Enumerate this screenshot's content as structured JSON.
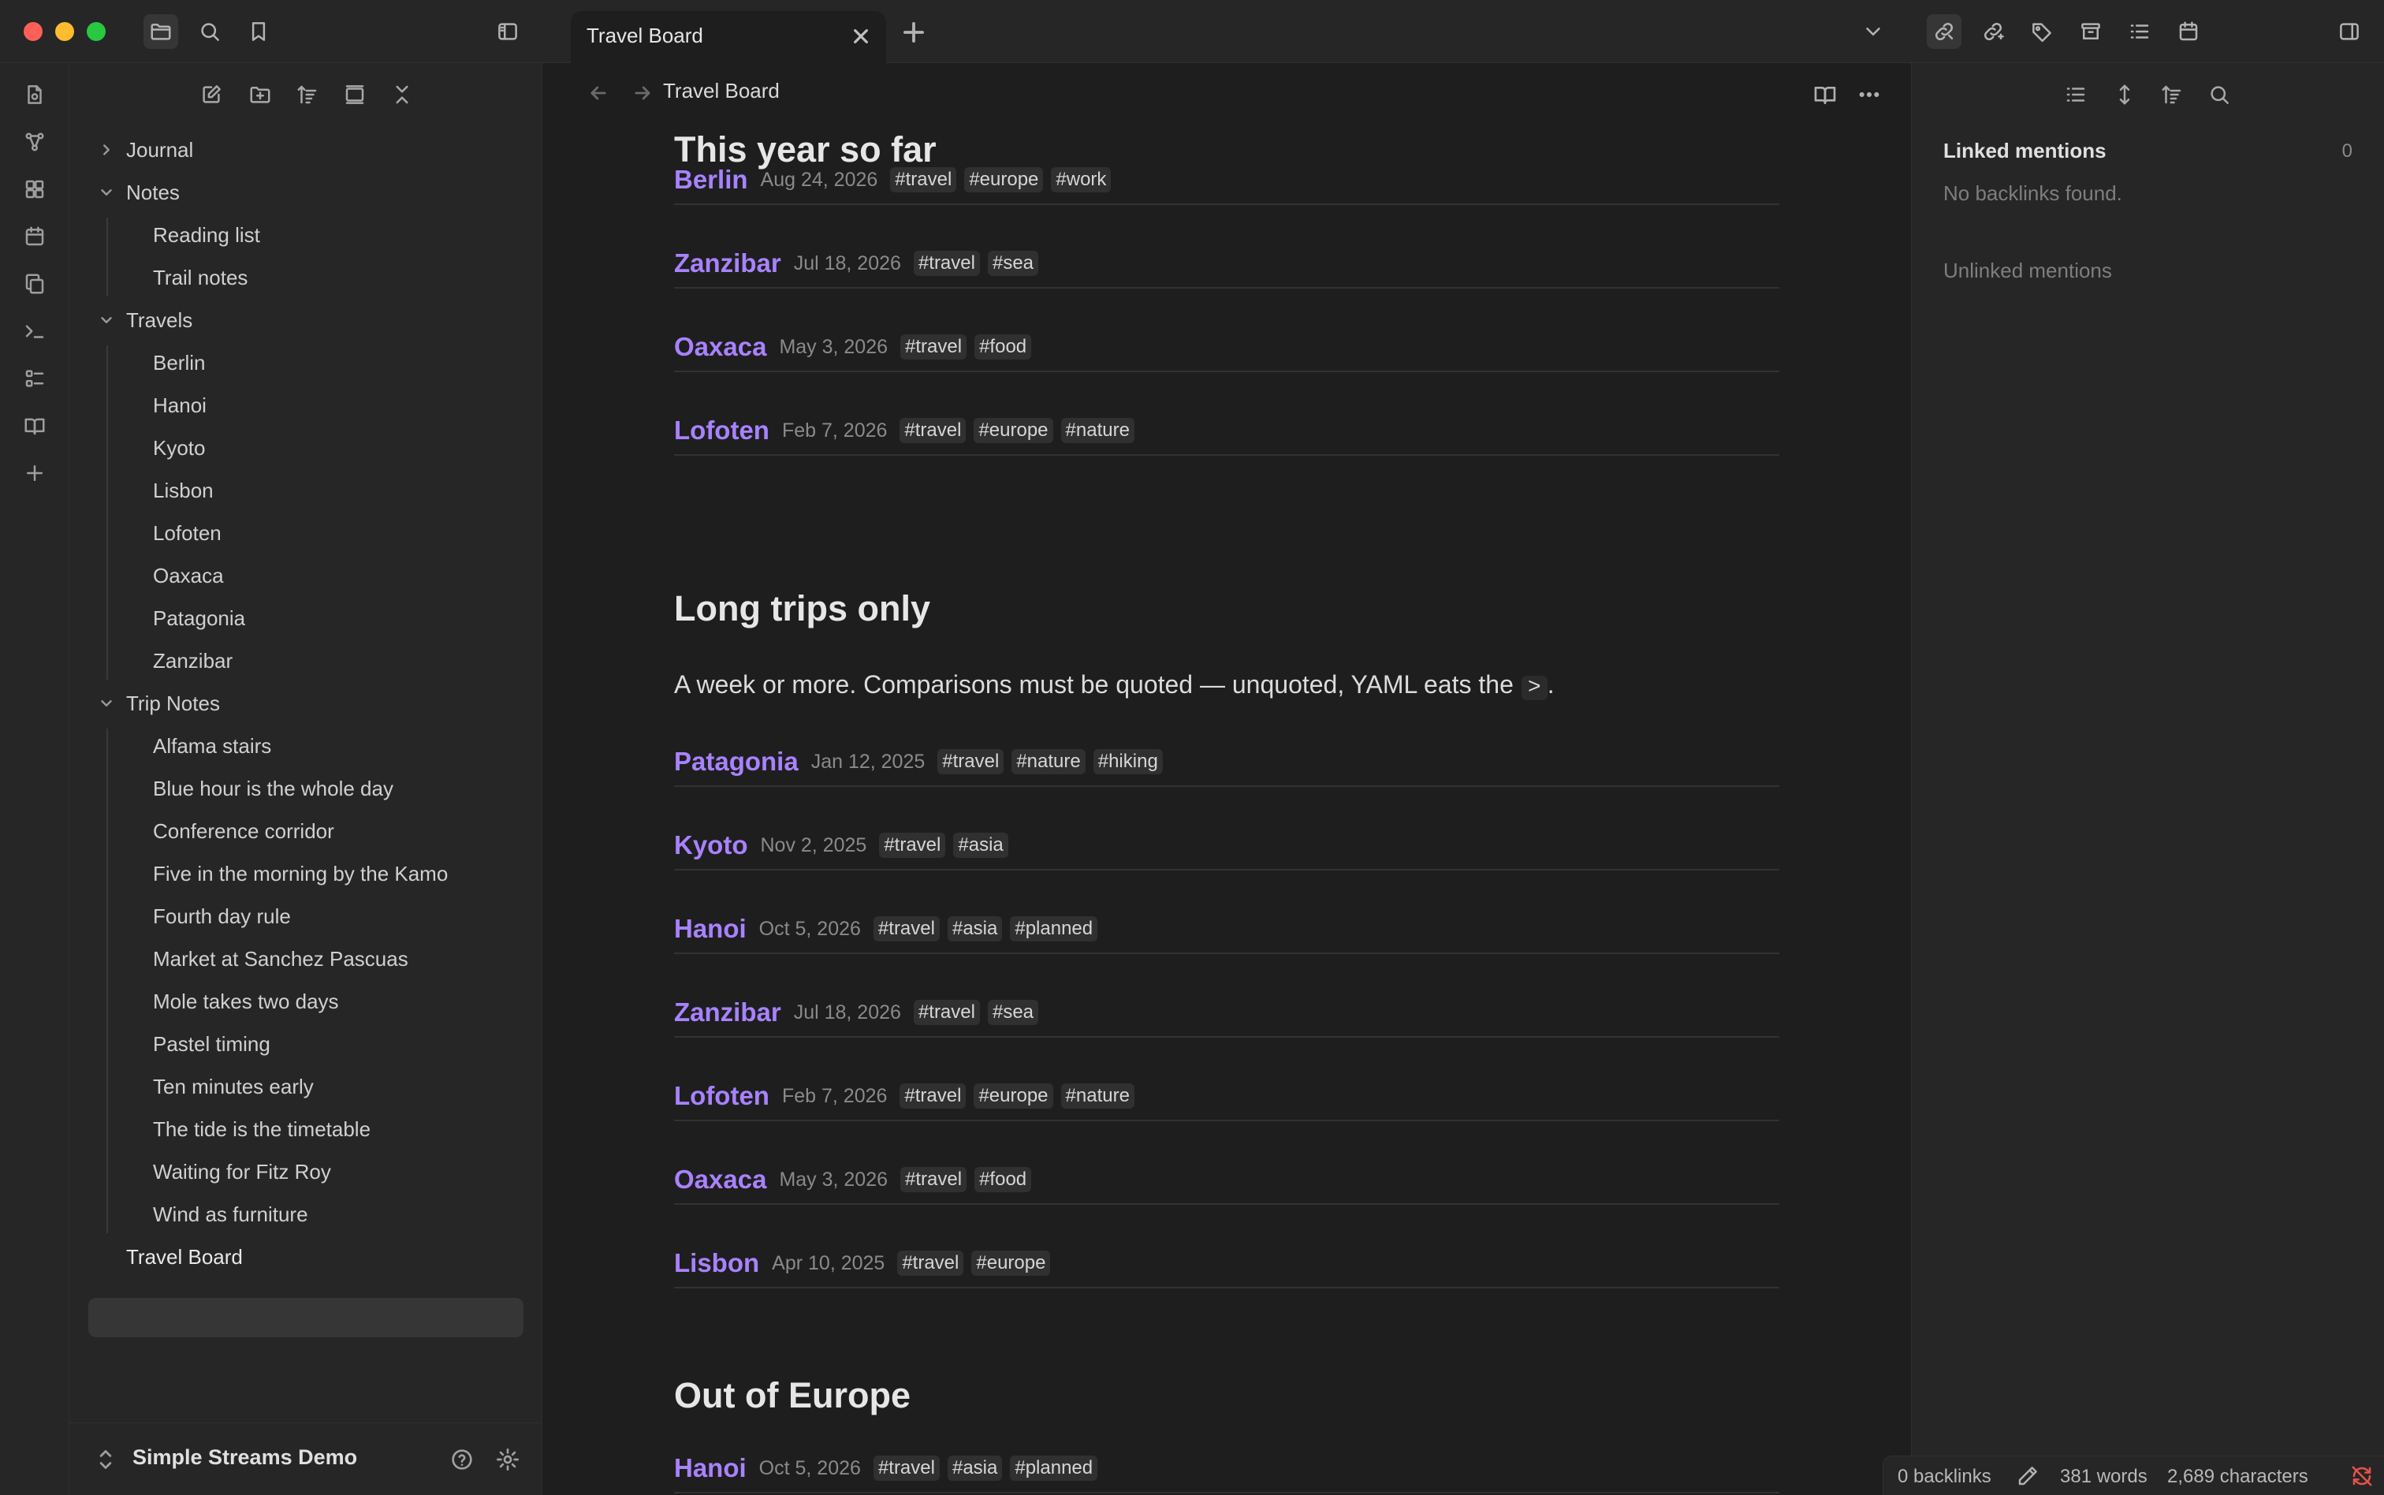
{
  "window": {
    "tab_title": "Travel Board",
    "view_title": "Travel Board"
  },
  "sidebar": {
    "tree": [
      {
        "type": "folder",
        "label": "Journal",
        "expanded": false
      },
      {
        "type": "folder",
        "label": "Notes",
        "expanded": true
      },
      {
        "type": "file",
        "label": "Reading list"
      },
      {
        "type": "file",
        "label": "Trail notes"
      },
      {
        "type": "folder",
        "label": "Travels",
        "expanded": true
      },
      {
        "type": "file",
        "label": "Berlin"
      },
      {
        "type": "file",
        "label": "Hanoi"
      },
      {
        "type": "file",
        "label": "Kyoto"
      },
      {
        "type": "file",
        "label": "Lisbon"
      },
      {
        "type": "file",
        "label": "Lofoten"
      },
      {
        "type": "file",
        "label": "Oaxaca"
      },
      {
        "type": "file",
        "label": "Patagonia"
      },
      {
        "type": "file",
        "label": "Zanzibar"
      },
      {
        "type": "folder",
        "label": "Trip Notes",
        "expanded": true
      },
      {
        "type": "file",
        "label": "Alfama stairs"
      },
      {
        "type": "file",
        "label": "Blue hour is the whole day"
      },
      {
        "type": "file",
        "label": "Conference corridor"
      },
      {
        "type": "file",
        "label": "Five in the morning by the Kamo"
      },
      {
        "type": "file",
        "label": "Fourth day rule"
      },
      {
        "type": "file",
        "label": "Market at Sanchez Pascuas"
      },
      {
        "type": "file",
        "label": "Mole takes two days"
      },
      {
        "type": "file",
        "label": "Pastel timing"
      },
      {
        "type": "file",
        "label": "Ten minutes early"
      },
      {
        "type": "file",
        "label": "The tide is the timetable"
      },
      {
        "type": "file",
        "label": "Waiting for Fitz Roy"
      },
      {
        "type": "file",
        "label": "Wind as furniture"
      },
      {
        "type": "root-file",
        "label": "Travel Board",
        "active": true
      }
    ],
    "vault_name": "Simple Streams Demo"
  },
  "document": {
    "sections": [
      {
        "heading": "This year so far",
        "entries": [
          {
            "title": "Berlin",
            "date": "Aug 24, 2026",
            "tags": [
              "#travel",
              "#europe",
              "#work"
            ]
          },
          {
            "title": "Zanzibar",
            "date": "Jul 18, 2026",
            "tags": [
              "#travel",
              "#sea"
            ]
          },
          {
            "title": "Oaxaca",
            "date": "May 3, 2026",
            "tags": [
              "#travel",
              "#food"
            ]
          },
          {
            "title": "Lofoten",
            "date": "Feb 7, 2026",
            "tags": [
              "#travel",
              "#europe",
              "#nature"
            ]
          }
        ]
      },
      {
        "heading": "Long trips only",
        "paragraph_before": "A week or more. Comparisons must be quoted — unquoted, YAML eats the",
        "paragraph_code": ">",
        "paragraph_after": ".",
        "entries": [
          {
            "title": "Patagonia",
            "date": "Jan 12, 2025",
            "tags": [
              "#travel",
              "#nature",
              "#hiking"
            ]
          },
          {
            "title": "Kyoto",
            "date": "Nov 2, 2025",
            "tags": [
              "#travel",
              "#asia"
            ]
          },
          {
            "title": "Hanoi",
            "date": "Oct 5, 2026",
            "tags": [
              "#travel",
              "#asia",
              "#planned"
            ]
          },
          {
            "title": "Zanzibar",
            "date": "Jul 18, 2026",
            "tags": [
              "#travel",
              "#sea"
            ]
          },
          {
            "title": "Lofoten",
            "date": "Feb 7, 2026",
            "tags": [
              "#travel",
              "#europe",
              "#nature"
            ]
          },
          {
            "title": "Oaxaca",
            "date": "May 3, 2026",
            "tags": [
              "#travel",
              "#food"
            ]
          },
          {
            "title": "Lisbon",
            "date": "Apr 10, 2025",
            "tags": [
              "#travel",
              "#europe"
            ]
          }
        ]
      },
      {
        "heading": "Out of Europe",
        "entries": [
          {
            "title": "Hanoi",
            "date": "Oct 5, 2026",
            "tags": [
              "#travel",
              "#asia",
              "#planned"
            ]
          }
        ]
      }
    ]
  },
  "backlinks": {
    "linked_label": "Linked mentions",
    "linked_count": "0",
    "empty_text": "No backlinks found.",
    "unlinked_label": "Unlinked mentions"
  },
  "status": {
    "backlinks": "0 backlinks",
    "words": "381 words",
    "characters": "2,689 characters"
  },
  "colors": {
    "accent": "#a882ff",
    "background": "#1e1e1e",
    "panel": "#262626",
    "sync_error": "#e5534b"
  }
}
